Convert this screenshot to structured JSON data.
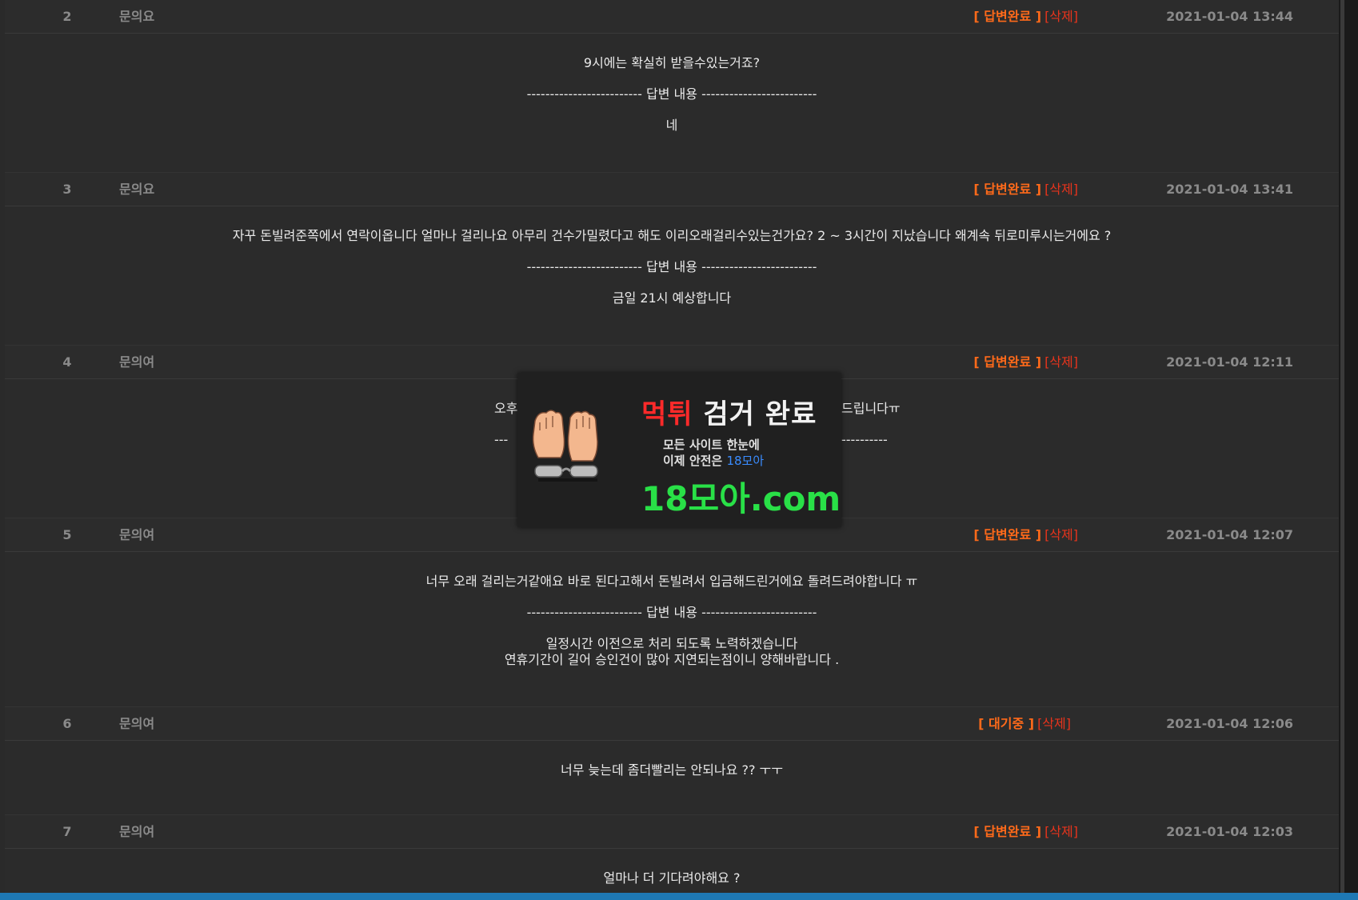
{
  "status_labels": {
    "answered": "[ 답변완료 ]",
    "waiting": "[ 대기중 ]",
    "delete": "[삭제]"
  },
  "separator": "------------------------- 답변 내용 -------------------------",
  "posts": [
    {
      "num": "2",
      "author": "문의요",
      "date": "2021-01-04 13:44",
      "question": "9시에는 확실히 받을수있는거죠?",
      "answer": [
        "네"
      ]
    },
    {
      "num": "3",
      "author": "문의요",
      "date": "2021-01-04 13:41",
      "question": "자꾸 돈빌려준쪽에서 연락이옵니다 얼마나 걸리나요 아무리 건수가밀렸다고 해도 이리오래걸리수있는건가요? 2 ~ 3시간이 지났습니다 왜계속 뒤로미루시는거에요 ?",
      "answer": [
        "금일 21시 예상합니다"
      ]
    },
    {
      "num": "4",
      "author": "문의여",
      "date": "2021-01-04 12:11",
      "question_left": "오후",
      "question_right": "드립니다ㅠ"
    },
    {
      "num": "5",
      "author": "문의여",
      "date": "2021-01-04 12:07",
      "question": "너무 오래 걸리는거같애요 바로 된다고해서 돈빌려서 입금해드린거에요 돌려드려야합니다 ㅠ",
      "answer": [
        "일정시간 이전으로 처리 되도록 노력하겠습니다",
        "연휴기간이 길어 승인건이 많아 지연되는점이니 양해바랍니다 ."
      ]
    },
    {
      "num": "6",
      "author": "문의여",
      "date": "2021-01-04 12:06",
      "question": "너무 늦는데 좀더빨리는 안되나요 ?? ㅜㅜ"
    },
    {
      "num": "7",
      "author": "문의여",
      "date": "2021-01-04 12:03",
      "question": "얼마나 더 기다려야해요 ?"
    }
  ],
  "ad": {
    "title_red": "먹튀",
    "title_rest": " 검거 완료",
    "line1": "모든 사이트 한눈에",
    "line2": "이제 안전은",
    "line2_brand": "18모아",
    "domain": "18모아.com"
  },
  "colors": {
    "status_orange": "#ff6a1a",
    "delete_red": "#e8341c",
    "ad_green": "#29e047",
    "ad_red": "#ff2a2a",
    "ad_blue": "#3a8cff",
    "taskbar": "#1e78b4"
  }
}
